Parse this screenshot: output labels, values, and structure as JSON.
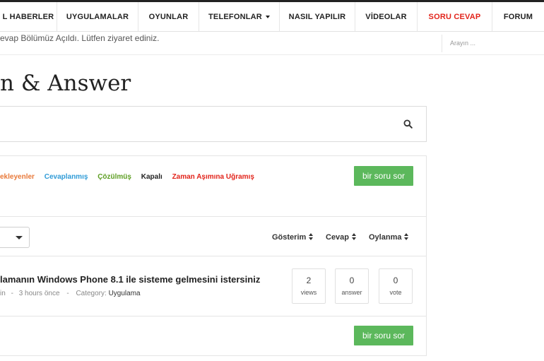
{
  "nav": {
    "items": [
      {
        "label": "L HABERLER",
        "has_caret": false,
        "active": false
      },
      {
        "label": "UYGULAMALAR",
        "has_caret": false,
        "active": false
      },
      {
        "label": "OYUNLAR",
        "has_caret": false,
        "active": false
      },
      {
        "label": "TELEFONLAR",
        "has_caret": true,
        "active": false
      },
      {
        "label": "NASIL YAPILIR",
        "has_caret": false,
        "active": false
      },
      {
        "label": "VİDEOLAR",
        "has_caret": false,
        "active": false
      },
      {
        "label": "SORU CEVAP",
        "has_caret": false,
        "active": true
      },
      {
        "label": "FORUM",
        "has_caret": false,
        "active": false
      }
    ]
  },
  "announcement": {
    "text": "evap Bölümüz Açıldı. Lütfen ziyaret ediniz."
  },
  "search": {
    "placeholder": "Arayın ..."
  },
  "page": {
    "title": "n & Answer"
  },
  "filters": {
    "links": [
      {
        "label": "ekleyenler",
        "color": "#e8793a"
      },
      {
        "label": "Cevaplanmış",
        "color": "#2f9bd7"
      },
      {
        "label": "Çözülmüş",
        "color": "#5d9e22"
      },
      {
        "label": "Kapalı",
        "color": "#222222"
      },
      {
        "label": "Zaman Aşımına Uğramış",
        "color": "#e2231a"
      }
    ],
    "ask_button": "bir soru sor"
  },
  "sort": {
    "views": "Gösterim",
    "answers": "Cevap",
    "votes": "Oylanma"
  },
  "question": {
    "title": "lamanın Windows Phone 8.1 ile sisteme gelmesini istersiniz",
    "author": "in",
    "time": "3 hours önce",
    "category_label": "Category:",
    "category": "Uygulama",
    "separator": "-",
    "stats": {
      "views": {
        "value": "2",
        "label": "views"
      },
      "answers": {
        "value": "0",
        "label": "answer"
      },
      "votes": {
        "value": "0",
        "label": "vote"
      }
    }
  },
  "footer": {
    "ask_button": "bir soru sor"
  },
  "colors": {
    "accent_red": "#e2231a",
    "button_green": "#5cb85c"
  }
}
